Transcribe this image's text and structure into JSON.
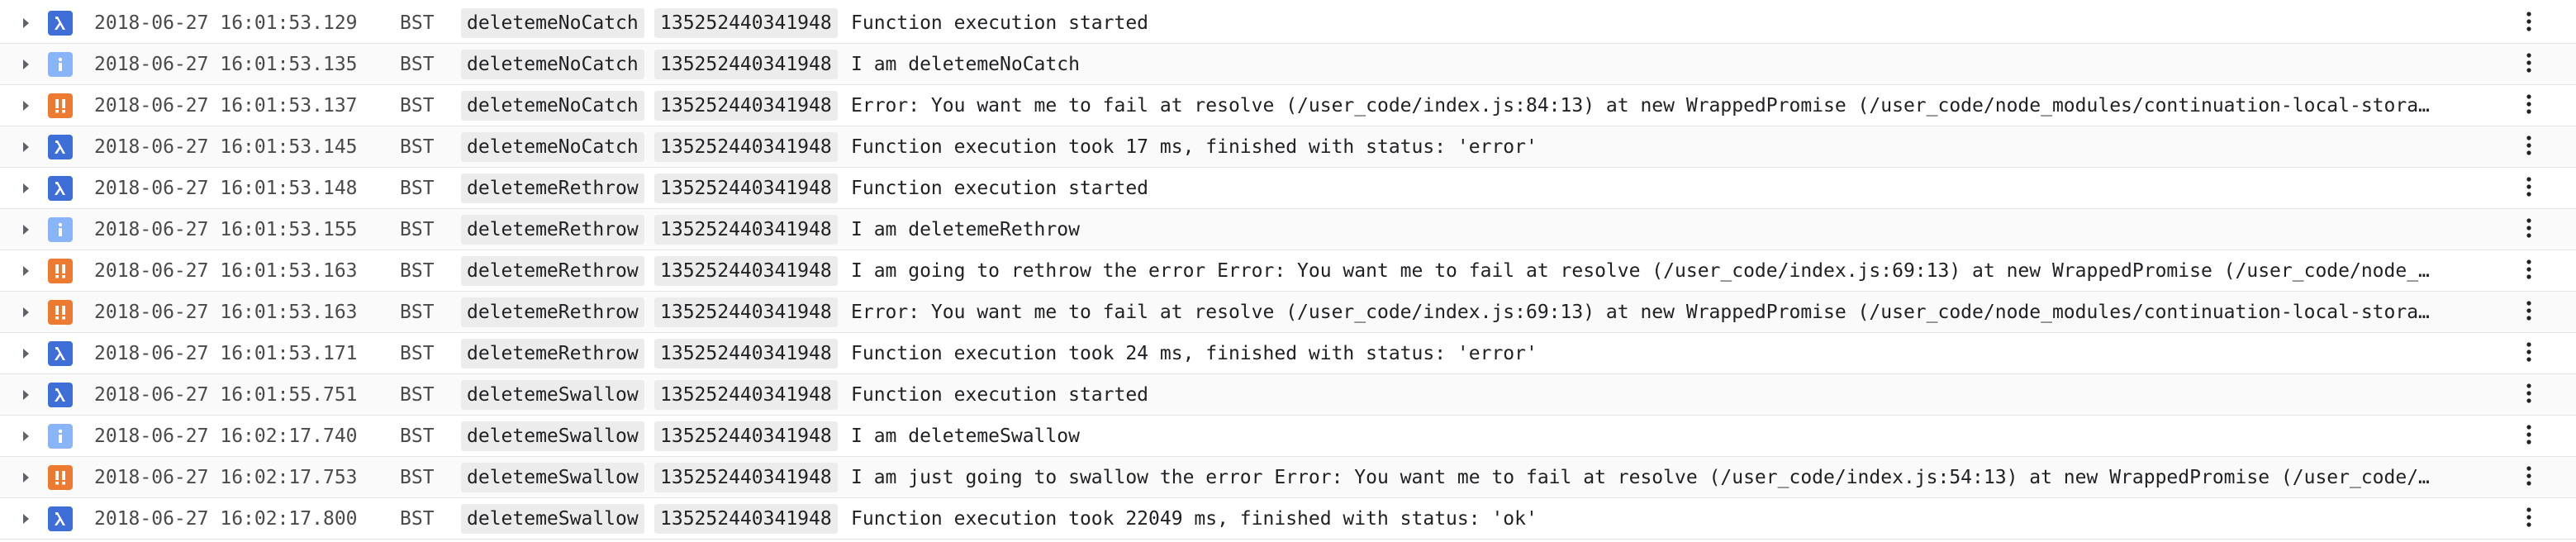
{
  "log_entries": [
    {
      "severity": "debug",
      "severity_icon": "lambda-icon",
      "date": "2018-06-27",
      "time": "16:01:53.129",
      "tz": "BST",
      "function": "deletemeNoCatch",
      "execution_id": "135252440341948",
      "message": "Function execution started"
    },
    {
      "severity": "info",
      "severity_icon": "info-icon",
      "date": "2018-06-27",
      "time": "16:01:53.135",
      "tz": "BST",
      "function": "deletemeNoCatch",
      "execution_id": "135252440341948",
      "message": "I am deletemeNoCatch"
    },
    {
      "severity": "error",
      "severity_icon": "double-exclamation-icon",
      "date": "2018-06-27",
      "time": "16:01:53.137",
      "tz": "BST",
      "function": "deletemeNoCatch",
      "execution_id": "135252440341948",
      "message": "Error: You want me to fail at resolve (/user_code/index.js:84:13) at new WrappedPromise (/user_code/node_modules/continuation-local-stora…"
    },
    {
      "severity": "debug",
      "severity_icon": "lambda-icon",
      "date": "2018-06-27",
      "time": "16:01:53.145",
      "tz": "BST",
      "function": "deletemeNoCatch",
      "execution_id": "135252440341948",
      "message": "Function execution took 17 ms, finished with status: 'error'"
    },
    {
      "severity": "debug",
      "severity_icon": "lambda-icon",
      "date": "2018-06-27",
      "time": "16:01:53.148",
      "tz": "BST",
      "function": "deletemeRethrow",
      "execution_id": "135252440341948",
      "message": "Function execution started"
    },
    {
      "severity": "info",
      "severity_icon": "info-icon",
      "date": "2018-06-27",
      "time": "16:01:53.155",
      "tz": "BST",
      "function": "deletemeRethrow",
      "execution_id": "135252440341948",
      "message": "I am deletemeRethrow"
    },
    {
      "severity": "error",
      "severity_icon": "double-exclamation-icon",
      "date": "2018-06-27",
      "time": "16:01:53.163",
      "tz": "BST",
      "function": "deletemeRethrow",
      "execution_id": "135252440341948",
      "message": "I am going to rethrow the error Error: You want me to fail at resolve (/user_code/index.js:69:13) at new WrappedPromise (/user_code/node_…"
    },
    {
      "severity": "error",
      "severity_icon": "double-exclamation-icon",
      "date": "2018-06-27",
      "time": "16:01:53.163",
      "tz": "BST",
      "function": "deletemeRethrow",
      "execution_id": "135252440341948",
      "message": "Error: You want me to fail at resolve (/user_code/index.js:69:13) at new WrappedPromise (/user_code/node_modules/continuation-local-stora…"
    },
    {
      "severity": "debug",
      "severity_icon": "lambda-icon",
      "date": "2018-06-27",
      "time": "16:01:53.171",
      "tz": "BST",
      "function": "deletemeRethrow",
      "execution_id": "135252440341948",
      "message": "Function execution took 24 ms, finished with status: 'error'"
    },
    {
      "severity": "debug",
      "severity_icon": "lambda-icon",
      "date": "2018-06-27",
      "time": "16:01:55.751",
      "tz": "BST",
      "function": "deletemeSwallow",
      "execution_id": "135252440341948",
      "message": "Function execution started"
    },
    {
      "severity": "info",
      "severity_icon": "info-icon",
      "date": "2018-06-27",
      "time": "16:02:17.740",
      "tz": "BST",
      "function": "deletemeSwallow",
      "execution_id": "135252440341948",
      "message": "I am deletemeSwallow"
    },
    {
      "severity": "error",
      "severity_icon": "double-exclamation-icon",
      "date": "2018-06-27",
      "time": "16:02:17.753",
      "tz": "BST",
      "function": "deletemeSwallow",
      "execution_id": "135252440341948",
      "message": "I am just going to swallow the error Error: You want me to fail at resolve (/user_code/index.js:54:13) at new WrappedPromise (/user_code/…"
    },
    {
      "severity": "debug",
      "severity_icon": "lambda-icon",
      "date": "2018-06-27",
      "time": "16:02:17.800",
      "tz": "BST",
      "function": "deletemeSwallow",
      "execution_id": "135252440341948",
      "message": "Function execution took 22049 ms, finished with status: 'ok'"
    }
  ],
  "colors": {
    "debug": "#3e6fd8",
    "info": "#8ab4f8",
    "error": "#ee7a32"
  }
}
